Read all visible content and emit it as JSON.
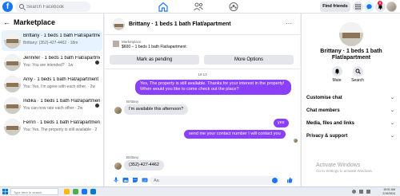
{
  "topbar": {
    "logo": "f",
    "search_placeholder": "Search Facebook",
    "find_friends": "Find friends",
    "notif_count": "3"
  },
  "sidebar": {
    "title": "Marketplace",
    "back_icon": "arrow-left-icon",
    "conversations": [
      {
        "title": "Brittany · 1 beds 1 bath Flat/apartment",
        "sub": "Brittany: (352)-427-4462 · 18m",
        "active": true
      },
      {
        "title": "Jennifer · 1 beds 1 bath Flat/apartment",
        "sub": "You: You are intended? · 1w",
        "unread": true
      },
      {
        "title": "Amy · 1 beds 1 bath Flat/apartment",
        "sub": "You: Yes, I'm agree with each other. · 2w"
      },
      {
        "title": "Indika · 1 beds 1 bath Flat/apartment",
        "sub": "You can now rate each other · 2w",
        "unread": true
      },
      {
        "title": "Ferrin · 1 beds 1 bath Flat/apartment",
        "sub": "You: Yes, The property is still available · 2w"
      }
    ]
  },
  "chat": {
    "header_title": "Brittany · 1 beds 1 bath Flat/apartment",
    "listing": {
      "label": "Marketplace",
      "title": "$600 – 1 beds 1 bath Flat/apartment",
      "mark_pending": "Mark as pending",
      "more_options": "More Options"
    },
    "timestamp": "19:13",
    "messages": {
      "out1": "Yes, The property is still available. Thanks for your interest in the property! When would you like to come check out the place?",
      "sender1": "Brittany",
      "in1": "I'm available this afternoon?",
      "out2": "yes",
      "out3": "send me your contact number I will contact you",
      "sender2": "Brittany",
      "in2": "(352)-427-4462"
    },
    "composer_placeholder": "Aa"
  },
  "info_panel": {
    "title": "Brittany · 1 beds 1 bath Flat/apartment",
    "mute": "Mute",
    "search": "Search",
    "rows": [
      "Customise chat",
      "Chat members",
      "Media, files and links",
      "Privacy & support"
    ]
  },
  "watermark": {
    "line1": "Activate Windows",
    "line2": "Go to Settings to activate Windows."
  },
  "taskbar": {
    "search_placeholder": "Type here to search",
    "time": "19:51 AM",
    "date": "2/16/2024"
  },
  "colors": {
    "brand": "#1877f2",
    "outgoing_bubble": "#8a3ffc",
    "incoming_bubble": "#e4e6eb"
  }
}
